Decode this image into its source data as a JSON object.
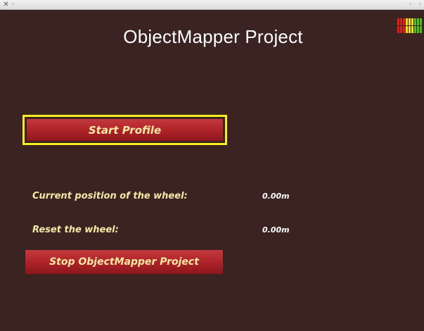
{
  "window": {
    "close_glyph": "✕",
    "min_glyph": "◦",
    "right_glyph_1": "◦",
    "right_glyph_2": "◦"
  },
  "app": {
    "title": "ObjectMapper Project"
  },
  "buttons": {
    "start_label": "Start Profile",
    "stop_label": "Stop ObjectMapper Project"
  },
  "rows": {
    "position_label": "Current position of the wheel:",
    "position_value": "0.00m",
    "reset_label": "Reset the wheel:",
    "reset_value": "0.00m"
  },
  "meter": {
    "colors": [
      "#e0201a",
      "#e0201a",
      "#e0201a",
      "#f2e21a",
      "#f2e21a",
      "#f2e21a",
      "#4cc21f",
      "#4cc21f",
      "#4cc21f"
    ]
  },
  "colors": {
    "background": "#3a2320",
    "button_red": "#b2252b",
    "button_text": "#f7e8a4",
    "focus_border": "#f6ec1e",
    "label_text": "#f5e9a8"
  }
}
